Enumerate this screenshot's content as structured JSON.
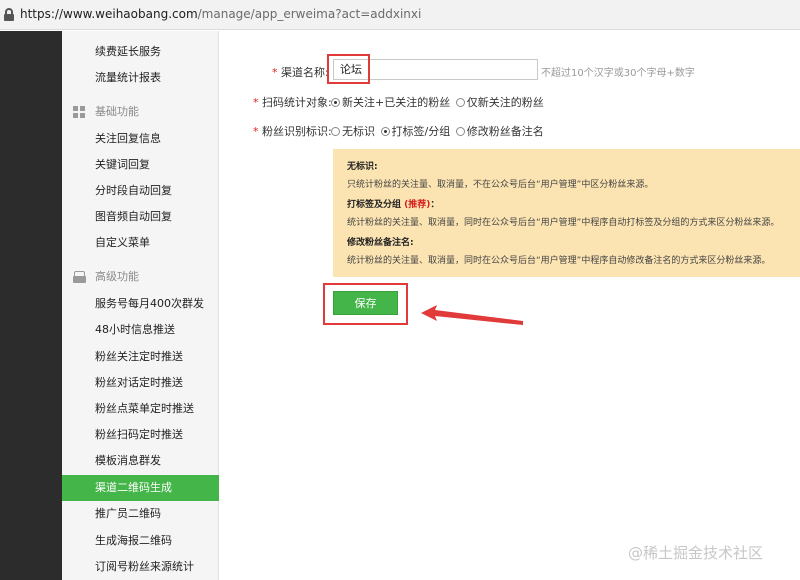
{
  "browser": {
    "url_host": "https://www.weihaobang.com",
    "url_path": "/manage/app_erweima?act=addxinxi"
  },
  "sidebar": {
    "items_top": [
      {
        "label": "续费延长服务"
      },
      {
        "label": "流量统计报表"
      }
    ],
    "section_basic": "基础功能",
    "items_basic": [
      {
        "label": "关注回复信息"
      },
      {
        "label": "关键词回复"
      },
      {
        "label": "分时段自动回复"
      },
      {
        "label": "图音频自动回复"
      },
      {
        "label": "自定义菜单"
      }
    ],
    "section_advanced": "高级功能",
    "items_advanced": [
      {
        "label": "服务号每月400次群发"
      },
      {
        "label": "48小时信息推送"
      },
      {
        "label": "粉丝关注定时推送"
      },
      {
        "label": "粉丝对话定时推送"
      },
      {
        "label": "粉丝点菜单定时推送"
      },
      {
        "label": "粉丝扫码定时推送"
      },
      {
        "label": "模板消息群发"
      },
      {
        "label": "渠道二维码生成"
      },
      {
        "label": "推广员二维码"
      },
      {
        "label": "生成海报二维码"
      },
      {
        "label": "订阅号粉丝来源统计"
      }
    ],
    "active_item": "渠道二维码生成"
  },
  "form": {
    "required_mark": "*",
    "channel_name_label": "渠道名称:",
    "channel_name_value": "论坛",
    "channel_name_hint": "不超过10个汉字或30个字母+数字",
    "scan_target_label": "扫码统计对象:",
    "scan_target_options": [
      {
        "label": "新关注+已关注的粉丝",
        "checked": true
      },
      {
        "label": "仅新关注的粉丝",
        "checked": false
      }
    ],
    "fan_tag_label": "粉丝识别标识:",
    "fan_tag_options": [
      {
        "label": "无标识",
        "checked": false
      },
      {
        "label": "打标签/分组",
        "checked": true
      },
      {
        "label": "修改粉丝备注名",
        "checked": false
      }
    ]
  },
  "notice": {
    "h1": "无标识:",
    "p1": "只统计粉丝的关注量、取消量，不在公众号后台“用户管理”中区分粉丝来源。",
    "h2": "打标签及分组",
    "h2_recommend": "(推荐)",
    "h2_suffix": "：",
    "p2": "统计粉丝的关注量、取消量，同时在公众号后台“用户管理”中程序自动打标签及分组的方式来区分粉丝来源。",
    "h3": "修改粉丝备注名:",
    "p3": "统计粉丝的关注量、取消量，同时在公众号后台“用户管理”中程序自动修改备注名的方式来区分粉丝来源。",
    "background": "#fce4b2"
  },
  "actions": {
    "save_label": "保存"
  },
  "colors": {
    "accent_green": "#44b549",
    "annotation_red": "#e03a3a",
    "sidebar_dark": "#2c2c2c"
  },
  "watermark": "@稀土掘金技术社区"
}
